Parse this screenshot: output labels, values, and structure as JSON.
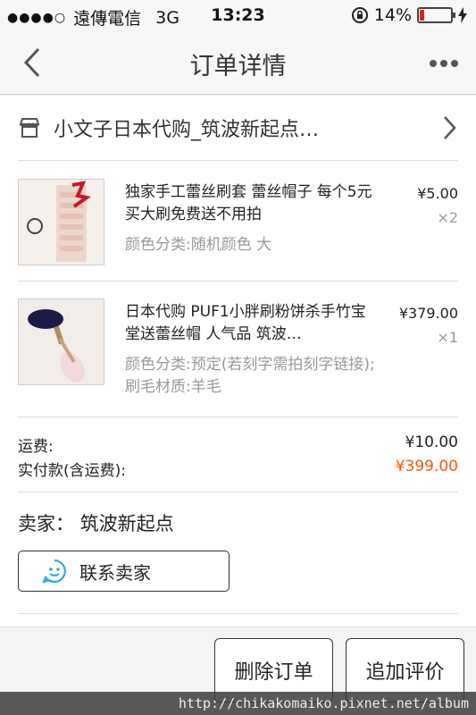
{
  "status_bar": {
    "signal": "●●●●○",
    "carrier": "遠傳電信",
    "network": "3G",
    "time": "13:23",
    "battery": "14%",
    "battery_level": 0.14,
    "icons": [
      "lock-rotation-icon",
      "charging-icon"
    ]
  },
  "navbar": {
    "title": "订单详情",
    "back_icon": "chevron-left-icon",
    "more_icon": "more-dots-icon"
  },
  "shop": {
    "name": "小文子日本代购_筑波新起点…",
    "icon": "store-icon",
    "chevron_icon": "chevron-right-icon"
  },
  "items": [
    {
      "title": "独家手工蕾丝刷套 蕾丝帽子 每个5元 买大刷免费送不用拍",
      "spec": "颜色分类:随机颜色 大",
      "price": "¥5.00",
      "qty": "×2"
    },
    {
      "title": "日本代购 PUF1小胖刷粉饼杀手竹宝堂送蕾丝帽 人气品 筑波…",
      "spec": "颜色分类:预定(若刻字需拍刻字链接);刷毛材质:羊毛",
      "price": "¥379.00",
      "qty": "×1"
    }
  ],
  "totals": {
    "shipping_label": "运费:",
    "shipping_value": "¥10.00",
    "paid_label": "实付款(含运费):",
    "paid_value": "¥399.00"
  },
  "seller": {
    "line": "卖家：  筑波新起点",
    "contact_label": "联系卖家",
    "contact_icon": "chat-face-icon"
  },
  "footer": {
    "delete_label": "删除订单",
    "review_label": "追加评价"
  },
  "watermark": "http://chikakomaiko.pixnet.net/album",
  "colors": {
    "accent_orange": "#ff5500",
    "battery_red": "#e02020",
    "contact_icon_blue": "#2ba7e0"
  }
}
